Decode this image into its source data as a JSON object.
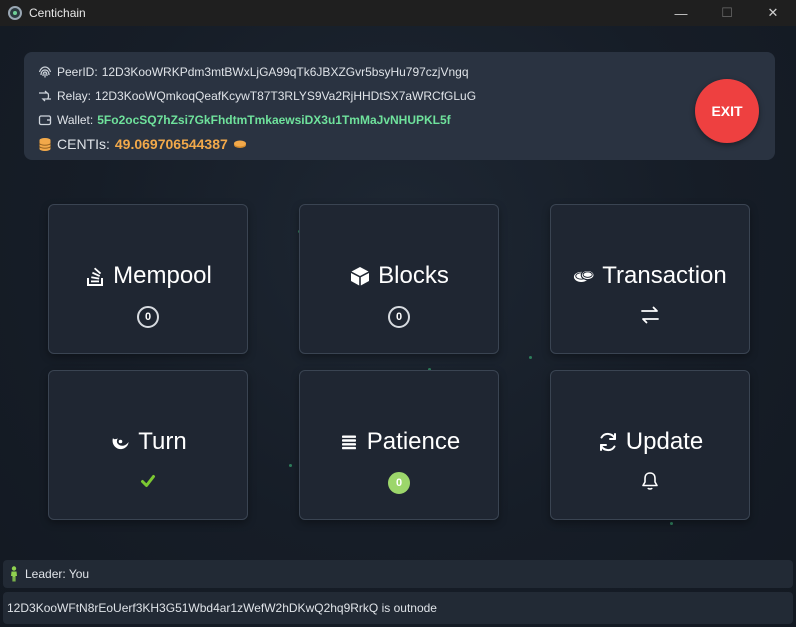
{
  "window": {
    "title": "Centichain",
    "minimize_glyph": "—",
    "maximize_glyph": "☐",
    "close_glyph": "✕"
  },
  "info": {
    "peer_label": "PeerID:",
    "peer_value": "12D3KooWRKPdm3mtBWxLjGA99qTk6JBXZGvr5bsyHu797czjVngq",
    "relay_label": "Relay:",
    "relay_value": "12D3KooWQmkoqQeafKcywT87T3RLYS9Va2RjHHDtSX7aWRCfGLuG",
    "wallet_label": "Wallet:",
    "wallet_value": "5Fo2ocSQ7hZsi7GkFhdtmTmkaewsiDX3u1TmMaJvNHUPKL5f",
    "centi_label": "CENTIs:",
    "centi_value": "49.069706544387",
    "exit_label": "EXIT"
  },
  "cards": {
    "mempool": {
      "label": "Mempool",
      "count": "0"
    },
    "blocks": {
      "label": "Blocks",
      "count": "0"
    },
    "transaction": {
      "label": "Transaction",
      "icon": "arrows-swap-icon"
    },
    "turn": {
      "label": "Turn",
      "icon": "checkmark-icon"
    },
    "patience": {
      "label": "Patience",
      "count": "0"
    },
    "update": {
      "label": "Update",
      "icon": "bell-icon"
    }
  },
  "status": {
    "leader_text": "Leader: You",
    "outnode_text": "12D3KooWFtN8rEoUerf3KH3G51Wbd4ar1zWefW2hDKwQ2hq9RrkQ is outnode"
  },
  "colors": {
    "exit": "#ee4040",
    "wallet": "#6fe29c",
    "centi": "#f2a94a",
    "check": "#7cc832",
    "patience_badge": "#9cd66b"
  }
}
